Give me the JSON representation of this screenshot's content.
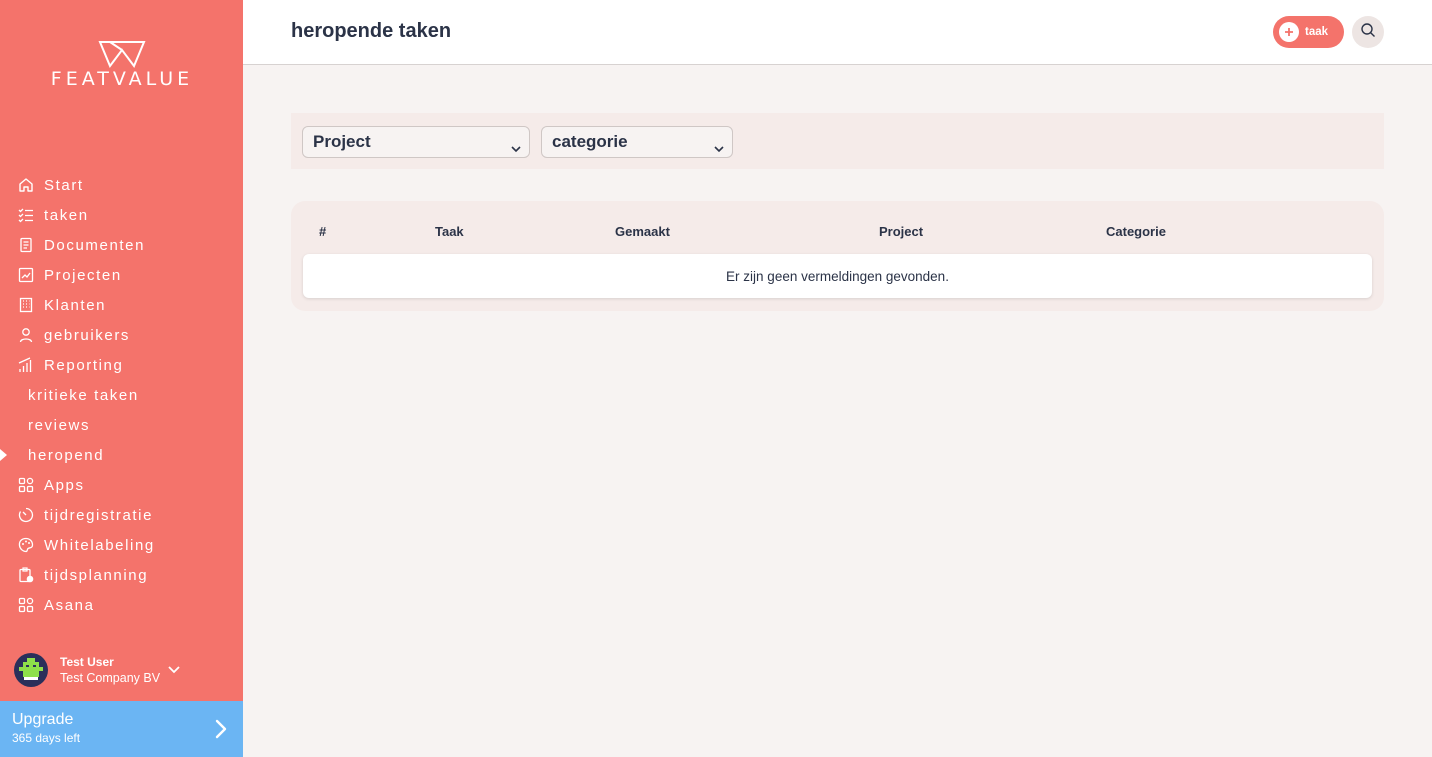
{
  "brand": {
    "name": "FEATVALUE",
    "primary_color": "#f4736b",
    "upgrade_color": "#6bb5f3"
  },
  "sidebar": {
    "items": [
      {
        "label": "Start",
        "icon": "home-icon"
      },
      {
        "label": "taken",
        "icon": "checklist-icon"
      },
      {
        "label": "Documenten",
        "icon": "document-icon"
      },
      {
        "label": "Projecten",
        "icon": "chart-file-icon"
      },
      {
        "label": "Klanten",
        "icon": "building-icon"
      },
      {
        "label": "gebruikers",
        "icon": "user-icon"
      },
      {
        "label": "Reporting",
        "icon": "bar-chart-icon"
      },
      {
        "label": "kritieke taken",
        "icon": null,
        "sub": true
      },
      {
        "label": "reviews",
        "icon": null,
        "sub": true
      },
      {
        "label": "heropend",
        "icon": null,
        "sub": true,
        "active": true
      },
      {
        "label": "Apps",
        "icon": "apps-icon"
      },
      {
        "label": "tijdregistratie",
        "icon": "timer-icon"
      },
      {
        "label": "Whitelabeling",
        "icon": "palette-icon"
      },
      {
        "label": "tijdsplanning",
        "icon": "clipboard-clock-icon"
      },
      {
        "label": "Asana",
        "icon": "apps-icon"
      }
    ],
    "user": {
      "name": "Test User",
      "company": "Test Company BV"
    },
    "upgrade": {
      "title": "Upgrade",
      "subtitle": "365 days left"
    }
  },
  "header": {
    "title": "heropende taken",
    "add_label": "taak"
  },
  "filters": {
    "project": "Project",
    "categorie": "categorie"
  },
  "table": {
    "columns": [
      "#",
      "Taak",
      "Gemaakt",
      "Project",
      "Categorie"
    ],
    "empty_message": "Er zijn geen vermeldingen gevonden."
  }
}
